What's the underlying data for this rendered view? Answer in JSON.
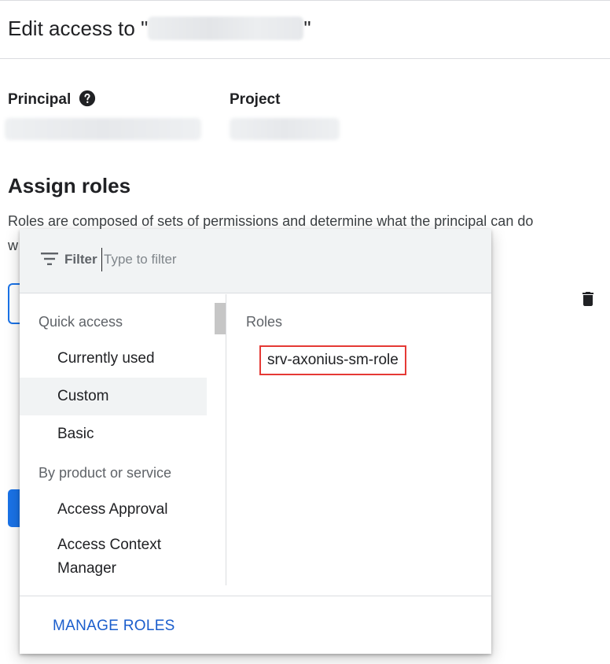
{
  "header": {
    "title_prefix": "Edit access to \"",
    "title_suffix": "\""
  },
  "principal": {
    "label": "Principal"
  },
  "project": {
    "label": "Project"
  },
  "assign_roles": {
    "title": "Assign roles",
    "description": "Roles are composed of sets of permissions and determine what the principal can do",
    "description_cont": "w"
  },
  "role_picker": {
    "filter_label": "Filter",
    "filter_placeholder": "Type to filter",
    "quick_access": {
      "header": "Quick access",
      "items": [
        "Currently used",
        "Custom",
        "Basic"
      ],
      "selected": "Custom"
    },
    "by_product": {
      "header": "By product or service",
      "items": [
        "Access Approval",
        "Access Context Manager"
      ]
    },
    "roles": {
      "header": "Roles",
      "items": [
        "srv-axonius-sm-role"
      ]
    },
    "manage_roles_label": "MANAGE ROLES"
  },
  "colors": {
    "accent": "#1a73e8",
    "link": "#1a5dcc",
    "highlight_box": "#e53935",
    "selected_bg": "#f1f3f4"
  },
  "icons": {
    "help": "help-icon",
    "delete": "trash-icon",
    "filter": "filter-icon"
  }
}
